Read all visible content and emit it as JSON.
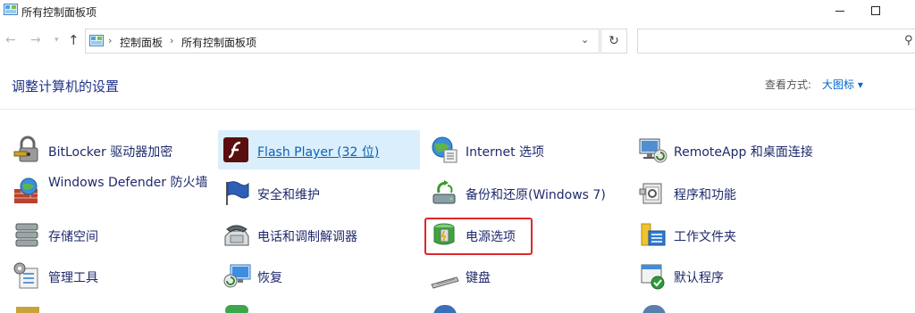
{
  "window": {
    "title": "所有控制面板项"
  },
  "address": {
    "crumbs": [
      "控制面板",
      "所有控制面板项"
    ],
    "separator": "›"
  },
  "header": {
    "title": "调整计算机的设置",
    "view_by_label": "查看方式:",
    "view_by_value": "大图标 ▾"
  },
  "colors": {
    "link": "#1f2a6b",
    "hover_bg": "#dbeefb",
    "accent": "#0066cc",
    "highlight": "#e0262b"
  },
  "items": [
    {
      "label": "BitLocker 驱动器加密",
      "icon": "bitlocker-icon"
    },
    {
      "label": "Flash Player (32 位)",
      "icon": "flash-icon"
    },
    {
      "label": "Internet 选项",
      "icon": "internet-options-icon"
    },
    {
      "label": "RemoteApp 和桌面连接",
      "icon": "remoteapp-icon"
    },
    {
      "label": "Windows Defender 防火墙",
      "icon": "firewall-icon"
    },
    {
      "label": "安全和维护",
      "icon": "security-flag-icon"
    },
    {
      "label": "备份和还原(Windows 7)",
      "icon": "backup-icon"
    },
    {
      "label": "程序和功能",
      "icon": "programs-icon"
    },
    {
      "label": "存储空间",
      "icon": "storage-icon"
    },
    {
      "label": "电话和调制解调器",
      "icon": "phone-icon"
    },
    {
      "label": "电源选项",
      "icon": "power-options-icon"
    },
    {
      "label": "工作文件夹",
      "icon": "work-folders-icon"
    },
    {
      "label": "管理工具",
      "icon": "admin-tools-icon"
    },
    {
      "label": "恢复",
      "icon": "recovery-icon"
    },
    {
      "label": "键盘",
      "icon": "keyboard-icon"
    },
    {
      "label": "默认程序",
      "icon": "default-programs-icon"
    }
  ]
}
